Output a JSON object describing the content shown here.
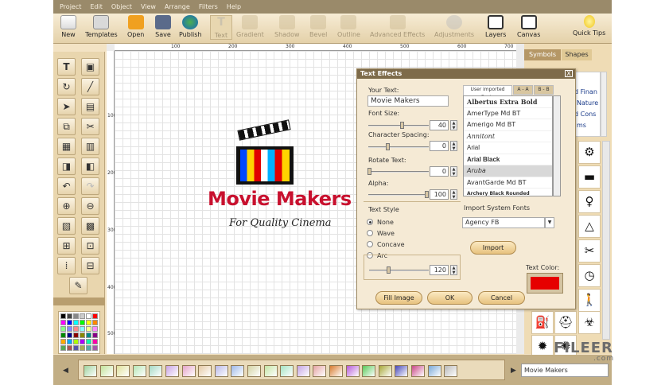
{
  "menu": [
    "Project",
    "Edit",
    "Object",
    "View",
    "Arrange",
    "Filters",
    "Help"
  ],
  "toolbar": {
    "new": "New",
    "templates": "Templates",
    "open": "Open",
    "save": "Save",
    "publish": "Publish",
    "text": "Text",
    "gradient": "Gradient",
    "shadow": "Shadow",
    "bevel": "Bevel",
    "outline": "Outline",
    "advanced_effects": "Advanced Effects",
    "adjustments": "Adjustments",
    "layers": "Layers",
    "canvas": "Canvas",
    "quick_tips": "Quick Tips"
  },
  "ruler": {
    "h": [
      "100",
      "200",
      "300",
      "400",
      "500",
      "600",
      "700"
    ],
    "v": [
      "100",
      "200",
      "300",
      "400",
      "500"
    ]
  },
  "canvas": {
    "logo_title": "Movie Makers",
    "logo_subtitle": "For Quality Cinema"
  },
  "dialog": {
    "title": "Text Effects",
    "close": "X",
    "your_text_label": "Your Text:",
    "your_text_value": "Movie Makers",
    "font_size_label": "Font Size:",
    "font_size_value": "40",
    "char_spacing_label": "Character Spacing:",
    "char_spacing_value": "0",
    "rotate_label": "Rotate Text:",
    "rotate_value": "0",
    "alpha_label": "Alpha:",
    "alpha_value": "100",
    "text_style_label": "Text Style",
    "styles": [
      "None",
      "Wave",
      "Concave",
      "Arc"
    ],
    "style_value": "120",
    "font_tabs": [
      "User imported Fonts",
      "A - A",
      "B - B"
    ],
    "fonts": [
      "Albertus Extra Bold",
      "AmerType Md BT",
      "Amerigo Md BT",
      "Annitont",
      "Arial",
      "Arial Black",
      "Aruba",
      "AvantGarde Md BT",
      "Archery Black Rounded"
    ],
    "import_system_label": "Import System Fonts",
    "system_font": "Agency FB",
    "import_button": "Import",
    "text_color_label": "Text Color:",
    "text_color": "#e60000",
    "fill_image": "Fill Image",
    "ok": "OK",
    "cancel": "Cancel"
  },
  "right_panel": {
    "tabs": [
      "Symbols",
      "Shapes"
    ],
    "list_items": [
      "d Finan",
      "Nature",
      "d Cons",
      "ms"
    ],
    "name_field": "Movie Makers"
  },
  "watermark": {
    "brand": "FILEER",
    "domain": ".com"
  }
}
